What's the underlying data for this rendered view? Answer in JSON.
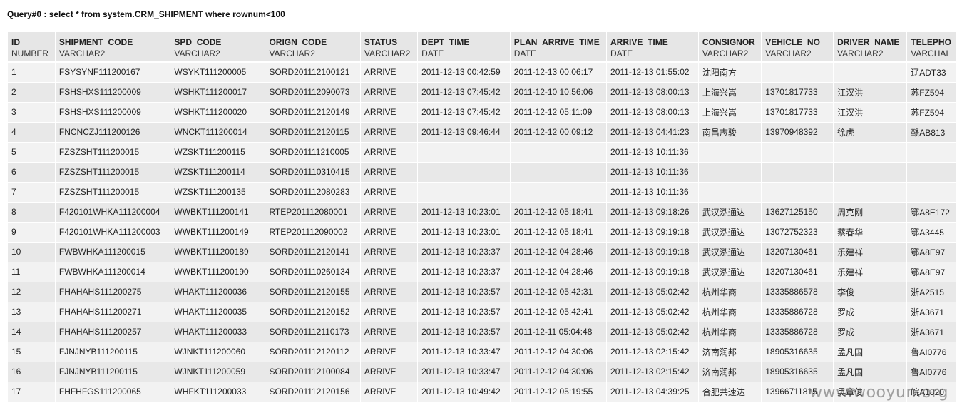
{
  "query": {
    "title": "Query#0 : select * from system.CRM_SHIPMENT where rownum<100"
  },
  "table": {
    "columns": [
      {
        "name": "ID",
        "type": "NUMBER"
      },
      {
        "name": "SHIPMENT_CODE",
        "type": "VARCHAR2"
      },
      {
        "name": "SPD_CODE",
        "type": "VARCHAR2"
      },
      {
        "name": "ORIGN_CODE",
        "type": "VARCHAR2"
      },
      {
        "name": "STATUS",
        "type": "VARCHAR2"
      },
      {
        "name": "DEPT_TIME",
        "type": "DATE"
      },
      {
        "name": "PLAN_ARRIVE_TIME",
        "type": "DATE"
      },
      {
        "name": "ARRIVE_TIME",
        "type": "DATE"
      },
      {
        "name": "CONSIGNOR",
        "type": "VARCHAR2"
      },
      {
        "name": "VEHICLE_NO",
        "type": "VARCHAR2"
      },
      {
        "name": "DRIVER_NAME",
        "type": "VARCHAR2"
      },
      {
        "name": "TELEPHO",
        "type": "VARCHAI"
      }
    ],
    "rows": [
      [
        "1",
        "FSYSYNF111200167",
        "WSYKT111200005",
        "SORD201112100121",
        "ARRIVE",
        "2011-12-13 00:42:59",
        "2011-12-13 00:06:17",
        "2011-12-13 01:55:02",
        "沈阳南方",
        "",
        "",
        "辽ADT33"
      ],
      [
        "2",
        "FSHSHXS111200009",
        "WSHKT111200017",
        "SORD201112090073",
        "ARRIVE",
        "2011-12-13 07:45:42",
        "2011-12-10 10:56:06",
        "2011-12-13 08:00:13",
        "上海兴嵩",
        "13701817733",
        "江汉洪",
        "苏FZ594"
      ],
      [
        "3",
        "FSHSHXS111200009",
        "WSHKT111200020",
        "SORD201112120149",
        "ARRIVE",
        "2011-12-13 07:45:42",
        "2011-12-12 05:11:09",
        "2011-12-13 08:00:13",
        "上海兴嵩",
        "13701817733",
        "江汉洪",
        "苏FZ594"
      ],
      [
        "4",
        "FNCNCZJ111200126",
        "WNCKT111200014",
        "SORD201112120115",
        "ARRIVE",
        "2011-12-13 09:46:44",
        "2011-12-12 00:09:12",
        "2011-12-13 04:41:23",
        "南昌志骏",
        "13970948392",
        "徐虎",
        "赣AB813"
      ],
      [
        "5",
        "FZSZSHT111200015",
        "WZSKT111200115",
        "SORD201111210005",
        "ARRIVE",
        "",
        "",
        "2011-12-13 10:11:36",
        "",
        "",
        "",
        ""
      ],
      [
        "6",
        "FZSZSHT111200015",
        "WZSKT111200114",
        "SORD201110310415",
        "ARRIVE",
        "",
        "",
        "2011-12-13 10:11:36",
        "",
        "",
        "",
        ""
      ],
      [
        "7",
        "FZSZSHT111200015",
        "WZSKT111200135",
        "SORD201112080283",
        "ARRIVE",
        "",
        "",
        "2011-12-13 10:11:36",
        "",
        "",
        "",
        ""
      ],
      [
        "8",
        "F420101WHKA111200004",
        "WWBKT111200141",
        "RTEP201112080001",
        "ARRIVE",
        "2011-12-13 10:23:01",
        "2011-12-12 05:18:41",
        "2011-12-13 09:18:26",
        "武汉泓通达",
        "13627125150",
        "周克刚",
        "鄂A8E172"
      ],
      [
        "9",
        "F420101WHKA111200003",
        "WWBKT111200149",
        "RTEP201112090002",
        "ARRIVE",
        "2011-12-13 10:23:01",
        "2011-12-12 05:18:41",
        "2011-12-13 09:19:18",
        "武汉泓通达",
        "13072752323",
        "蔡春华",
        "鄂A3445"
      ],
      [
        "10",
        "FWBWHKA111200015",
        "WWBKT111200189",
        "SORD201112120141",
        "ARRIVE",
        "2011-12-13 10:23:37",
        "2011-12-12 04:28:46",
        "2011-12-13 09:19:18",
        "武汉泓通达",
        "13207130461",
        "乐建祥",
        "鄂A8E97"
      ],
      [
        "11",
        "FWBWHKA111200014",
        "WWBKT111200190",
        "SORD201110260134",
        "ARRIVE",
        "2011-12-13 10:23:37",
        "2011-12-12 04:28:46",
        "2011-12-13 09:19:18",
        "武汉泓通达",
        "13207130461",
        "乐建祥",
        "鄂A8E97"
      ],
      [
        "12",
        "FHAHAHS111200275",
        "WHAKT111200036",
        "SORD201112120155",
        "ARRIVE",
        "2011-12-13 10:23:57",
        "2011-12-12 05:42:31",
        "2011-12-13 05:02:42",
        "杭州华商",
        "13335886578",
        "李俊",
        "浙A2515"
      ],
      [
        "13",
        "FHAHAHS111200271",
        "WHAKT111200035",
        "SORD201112120152",
        "ARRIVE",
        "2011-12-13 10:23:57",
        "2011-12-12 05:42:41",
        "2011-12-13 05:02:42",
        "杭州华商",
        "13335886728",
        "罗成",
        "浙A3671"
      ],
      [
        "14",
        "FHAHAHS111200257",
        "WHAKT111200033",
        "SORD201112110173",
        "ARRIVE",
        "2011-12-13 10:23:57",
        "2011-12-11 05:04:48",
        "2011-12-13 05:02:42",
        "杭州华商",
        "13335886728",
        "罗成",
        "浙A3671"
      ],
      [
        "15",
        "FJNJNYB111200115",
        "WJNKT111200060",
        "SORD201112120112",
        "ARRIVE",
        "2011-12-13 10:33:47",
        "2011-12-12 04:30:06",
        "2011-12-13 02:15:42",
        "济南润邦",
        "18905316635",
        "孟凡国",
        "鲁AI0776"
      ],
      [
        "16",
        "FJNJNYB111200115",
        "WJNKT111200059",
        "SORD201112100084",
        "ARRIVE",
        "2011-12-13 10:33:47",
        "2011-12-12 04:30:06",
        "2011-12-13 02:15:42",
        "济南润邦",
        "18905316635",
        "孟凡国",
        "鲁AI0776"
      ],
      [
        "17",
        "FHFHFGS111200065",
        "WHFKT111200033",
        "SORD201112120156",
        "ARRIVE",
        "2011-12-13 10:49:42",
        "2011-12-12 05:19:55",
        "2011-12-13 04:39:25",
        "合肥共速达",
        "13966711815",
        "吴章俊",
        "皖A1820"
      ]
    ]
  },
  "watermark": "www.wooyun.org"
}
